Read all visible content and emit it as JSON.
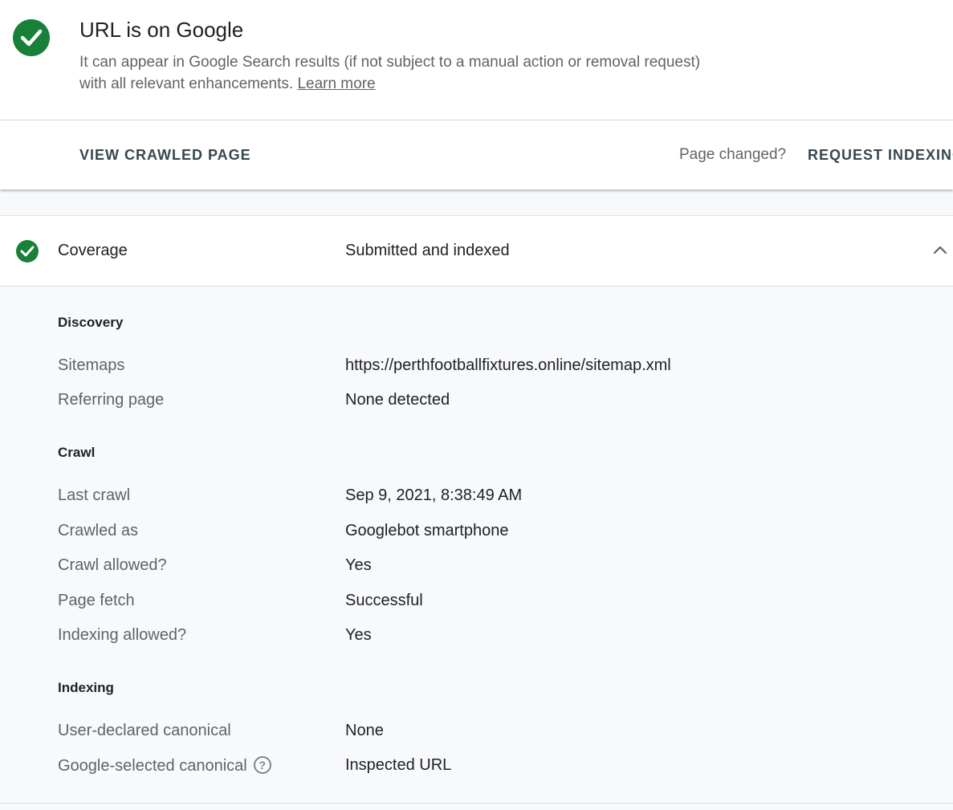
{
  "status": {
    "title": "URL is on Google",
    "description": "It can appear in Google Search results (if not subject to a manual action or removal request) with all relevant enhancements.",
    "learn_more": "Learn more",
    "icon": "check-circle-icon",
    "color": "#188038"
  },
  "actions": {
    "view_crawled": "VIEW CRAWLED PAGE",
    "page_changed": "Page changed?",
    "request_indexing": "REQUEST INDEXING"
  },
  "coverage": {
    "label": "Coverage",
    "value": "Submitted and indexed",
    "icon": "check-circle-icon",
    "expand_icon": "chevron-up-icon"
  },
  "discovery": {
    "heading": "Discovery",
    "rows": [
      {
        "label": "Sitemaps",
        "value": "https://perthfootballfixtures.online/sitemap.xml"
      },
      {
        "label": "Referring page",
        "value": "None detected"
      }
    ]
  },
  "crawl": {
    "heading": "Crawl",
    "rows": [
      {
        "label": "Last crawl",
        "value": "Sep 9, 2021, 8:38:49 AM"
      },
      {
        "label": "Crawled as",
        "value": "Googlebot smartphone"
      },
      {
        "label": "Crawl allowed?",
        "value": "Yes"
      },
      {
        "label": "Page fetch",
        "value": "Successful"
      },
      {
        "label": "Indexing allowed?",
        "value": "Yes"
      }
    ]
  },
  "indexing": {
    "heading": "Indexing",
    "rows": [
      {
        "label": "User-declared canonical",
        "value": "None"
      },
      {
        "label": "Google-selected canonical",
        "value": "Inspected URL"
      }
    ],
    "help_icon": "help-circle-icon"
  }
}
